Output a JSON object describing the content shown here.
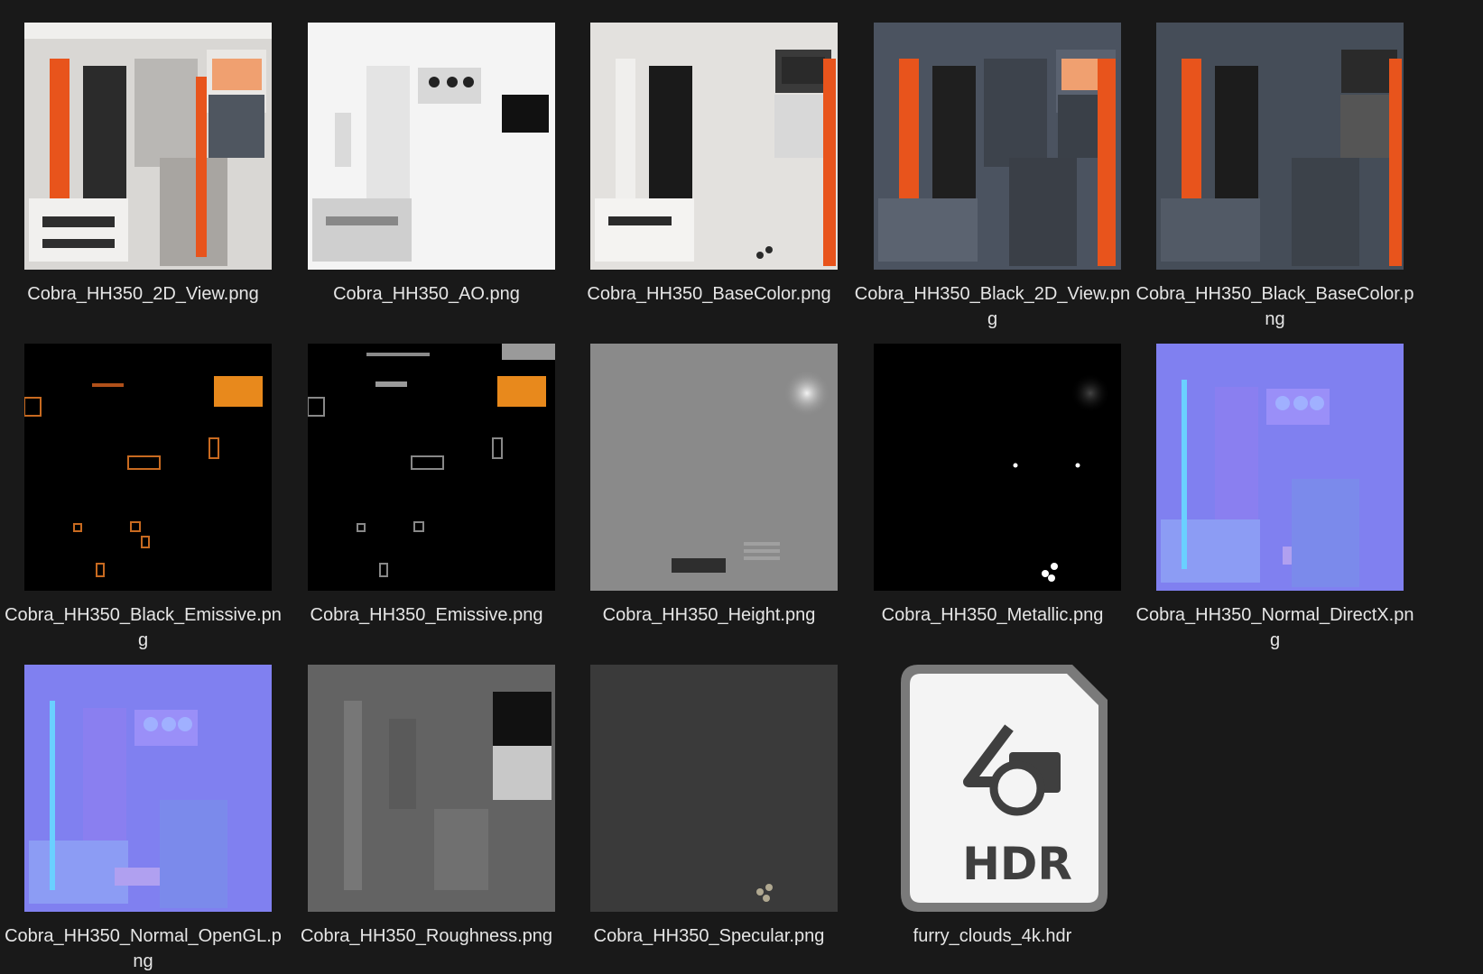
{
  "files": [
    {
      "name": "Cobra_HH350_2D_View.png",
      "kind": "2d-view-white"
    },
    {
      "name": "Cobra_HH350_AO.png",
      "kind": "ao"
    },
    {
      "name": "Cobra_HH350_BaseColor.png",
      "kind": "basecolor-white"
    },
    {
      "name": "Cobra_HH350_Black_2D_View.png",
      "kind": "2d-view-black"
    },
    {
      "name": "Cobra_HH350_Black_BaseColor.png",
      "kind": "basecolor-black"
    },
    {
      "name": "Cobra_HH350_Black_Emissive.png",
      "kind": "emissive-black"
    },
    {
      "name": "Cobra_HH350_Emissive.png",
      "kind": "emissive"
    },
    {
      "name": "Cobra_HH350_Height.png",
      "kind": "height"
    },
    {
      "name": "Cobra_HH350_Metallic.png",
      "kind": "metallic"
    },
    {
      "name": "Cobra_HH350_Normal_DirectX.png",
      "kind": "normal"
    },
    {
      "name": "Cobra_HH350_Normal_OpenGL.png",
      "kind": "normal"
    },
    {
      "name": "Cobra_HH350_Roughness.png",
      "kind": "roughness"
    },
    {
      "name": "Cobra_HH350_Specular.png",
      "kind": "specular"
    },
    {
      "name": "furry_clouds_4k.hdr",
      "kind": "hdr-file",
      "icon_text": "HDR"
    }
  ],
  "colors": {
    "background": "#191919",
    "accent_orange": "#e8541c",
    "label_text": "#e6e6e6"
  }
}
